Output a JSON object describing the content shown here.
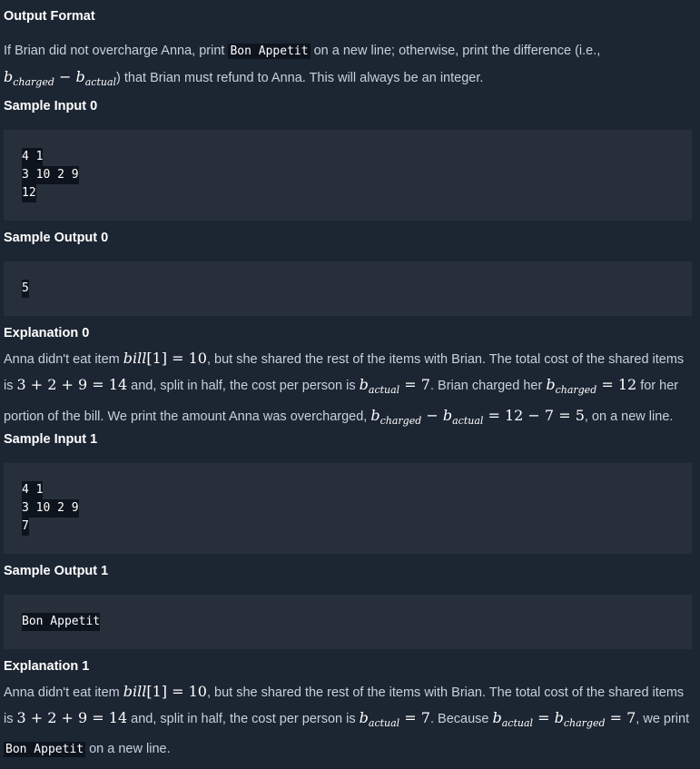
{
  "output_format": {
    "heading": "Output Format",
    "text_1": "If Brian did not overcharge Anna, print ",
    "code": "Bon Appetit",
    "text_2": " on a new line; otherwise, print the difference (i.e.,",
    "text_3": ") that Brian must refund to Anna. This will always be an integer."
  },
  "sample_input_0": {
    "heading": "Sample Input 0",
    "lines": [
      "4 1",
      "3 10 2 9",
      "12"
    ]
  },
  "sample_output_0": {
    "heading": "Sample Output 0",
    "lines": [
      "5"
    ]
  },
  "explanation_0": {
    "heading": "Explanation 0",
    "t1": "Anna didn't eat item ",
    "t2": ", but she shared the rest of the items with Brian. The total cost of the shared items",
    "t3": "is ",
    "t4": " and, split in half, the cost per person is ",
    "t5": ". Brian charged her ",
    "t6": " for her",
    "t7": "portion of the bill. We print the amount Anna was overcharged, ",
    "t8": ", on a new line."
  },
  "sample_input_1": {
    "heading": "Sample Input 1",
    "lines": [
      "4 1",
      "3 10 2 9",
      "7"
    ]
  },
  "sample_output_1": {
    "heading": "Sample Output 1",
    "lines": [
      "Bon Appetit"
    ]
  },
  "explanation_1": {
    "heading": "Explanation 1",
    "t1": "Anna didn't eat item ",
    "t2": ", but she shared the rest of the items with Brian. The total cost of the shared items",
    "t3": "is ",
    "t4": " and, split in half, the cost per person is ",
    "t5": ". Because ",
    "t6": ", we print",
    "code": "Bon Appetit",
    "t7": " on a new line."
  },
  "math": {
    "b": "b",
    "charged": "charged",
    "actual": "actual",
    "minus": " − ",
    "eq": " = ",
    "bill": "bill",
    "bill_idx": "[1]",
    "ten": "10",
    "sum": "3 + 2 + 9",
    "fourteen": "14",
    "seven": "7",
    "twelve": "12",
    "diff": "12 − 7",
    "five": "5"
  }
}
